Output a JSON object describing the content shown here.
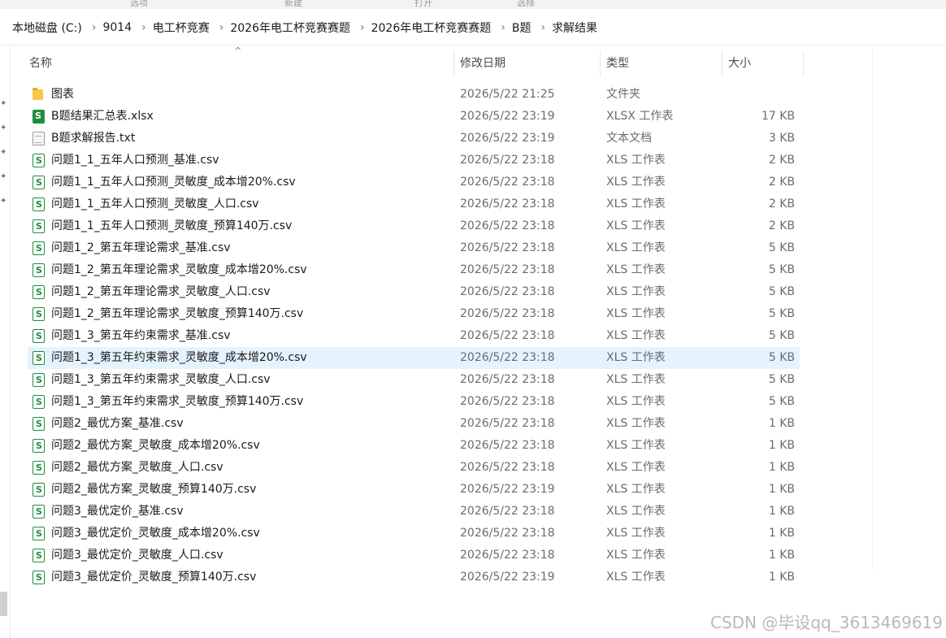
{
  "ribbon": {
    "labels": [
      "选项",
      "新建",
      "打开",
      "选择"
    ]
  },
  "breadcrumb": [
    "本地磁盘 (C:)",
    "9014",
    "电工杯竞赛",
    "2026年电工杯竞赛赛题",
    "2026年电工杯竞赛赛题",
    "B题",
    "求解结果"
  ],
  "columns": {
    "name": "名称",
    "date": "修改日期",
    "type": "类型",
    "size": "大小"
  },
  "files": [
    {
      "name": "图表",
      "date": "2026/5/22 21:25",
      "type": "文件夹",
      "size": "",
      "icon": "folder-icon"
    },
    {
      "name": "B题结果汇总表.xlsx",
      "date": "2026/5/22 23:19",
      "type": "XLSX 工作表",
      "size": "17 KB",
      "icon": "xlsx-icon"
    },
    {
      "name": "B题求解报告.txt",
      "date": "2026/5/22 23:19",
      "type": "文本文档",
      "size": "3 KB",
      "icon": "text-file-icon"
    },
    {
      "name": "问题1_1_五年人口预测_基准.csv",
      "date": "2026/5/22 23:18",
      "type": "XLS 工作表",
      "size": "2 KB",
      "icon": "csv-icon"
    },
    {
      "name": "问题1_1_五年人口预测_灵敏度_成本增20%.csv",
      "date": "2026/5/22 23:18",
      "type": "XLS 工作表",
      "size": "2 KB",
      "icon": "csv-icon"
    },
    {
      "name": "问题1_1_五年人口预测_灵敏度_人口.csv",
      "date": "2026/5/22 23:18",
      "type": "XLS 工作表",
      "size": "2 KB",
      "icon": "csv-icon"
    },
    {
      "name": "问题1_1_五年人口预测_灵敏度_预算140万.csv",
      "date": "2026/5/22 23:18",
      "type": "XLS 工作表",
      "size": "2 KB",
      "icon": "csv-icon"
    },
    {
      "name": "问题1_2_第五年理论需求_基准.csv",
      "date": "2026/5/22 23:18",
      "type": "XLS 工作表",
      "size": "5 KB",
      "icon": "csv-icon"
    },
    {
      "name": "问题1_2_第五年理论需求_灵敏度_成本增20%.csv",
      "date": "2026/5/22 23:18",
      "type": "XLS 工作表",
      "size": "5 KB",
      "icon": "csv-icon"
    },
    {
      "name": "问题1_2_第五年理论需求_灵敏度_人口.csv",
      "date": "2026/5/22 23:18",
      "type": "XLS 工作表",
      "size": "5 KB",
      "icon": "csv-icon"
    },
    {
      "name": "问题1_2_第五年理论需求_灵敏度_预算140万.csv",
      "date": "2026/5/22 23:18",
      "type": "XLS 工作表",
      "size": "5 KB",
      "icon": "csv-icon"
    },
    {
      "name": "问题1_3_第五年约束需求_基准.csv",
      "date": "2026/5/22 23:18",
      "type": "XLS 工作表",
      "size": "5 KB",
      "icon": "csv-icon"
    },
    {
      "name": "问题1_3_第五年约束需求_灵敏度_成本增20%.csv",
      "date": "2026/5/22 23:18",
      "type": "XLS 工作表",
      "size": "5 KB",
      "icon": "csv-icon",
      "selected": true
    },
    {
      "name": "问题1_3_第五年约束需求_灵敏度_人口.csv",
      "date": "2026/5/22 23:18",
      "type": "XLS 工作表",
      "size": "5 KB",
      "icon": "csv-icon"
    },
    {
      "name": "问题1_3_第五年约束需求_灵敏度_预算140万.csv",
      "date": "2026/5/22 23:18",
      "type": "XLS 工作表",
      "size": "5 KB",
      "icon": "csv-icon"
    },
    {
      "name": "问题2_最优方案_基准.csv",
      "date": "2026/5/22 23:18",
      "type": "XLS 工作表",
      "size": "1 KB",
      "icon": "csv-icon"
    },
    {
      "name": "问题2_最优方案_灵敏度_成本增20%.csv",
      "date": "2026/5/22 23:18",
      "type": "XLS 工作表",
      "size": "1 KB",
      "icon": "csv-icon"
    },
    {
      "name": "问题2_最优方案_灵敏度_人口.csv",
      "date": "2026/5/22 23:18",
      "type": "XLS 工作表",
      "size": "1 KB",
      "icon": "csv-icon"
    },
    {
      "name": "问题2_最优方案_灵敏度_预算140万.csv",
      "date": "2026/5/22 23:19",
      "type": "XLS 工作表",
      "size": "1 KB",
      "icon": "csv-icon"
    },
    {
      "name": "问题3_最优定价_基准.csv",
      "date": "2026/5/22 23:18",
      "type": "XLS 工作表",
      "size": "1 KB",
      "icon": "csv-icon"
    },
    {
      "name": "问题3_最优定价_灵敏度_成本增20%.csv",
      "date": "2026/5/22 23:18",
      "type": "XLS 工作表",
      "size": "1 KB",
      "icon": "csv-icon"
    },
    {
      "name": "问题3_最优定价_灵敏度_人口.csv",
      "date": "2026/5/22 23:18",
      "type": "XLS 工作表",
      "size": "1 KB",
      "icon": "csv-icon"
    },
    {
      "name": "问题3_最优定价_灵敏度_预算140万.csv",
      "date": "2026/5/22 23:19",
      "type": "XLS 工作表",
      "size": "1 KB",
      "icon": "csv-icon"
    }
  ],
  "watermark": "CSDN @毕设qq_3613469619",
  "colors": {
    "selected_row": "#e5f3ff",
    "csv_green": "#1e8e3e",
    "folder_yellow": "#f7c64a"
  }
}
